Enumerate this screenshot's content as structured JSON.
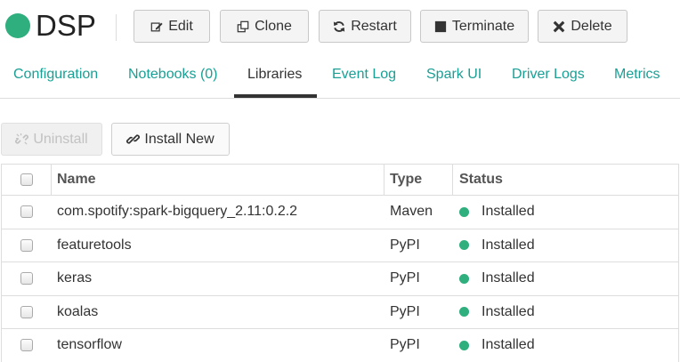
{
  "colors": {
    "accent": "#1a9f94",
    "status_ok": "#2fae7e",
    "active_tab": "#333333"
  },
  "cluster": {
    "name": "DSP",
    "status_icon": "green-status-dot"
  },
  "toolbar": {
    "edit": {
      "label": "Edit",
      "icon": "edit-icon"
    },
    "clone": {
      "label": "Clone",
      "icon": "clone-icon"
    },
    "restart": {
      "label": "Restart",
      "icon": "refresh-icon"
    },
    "terminate": {
      "label": "Terminate",
      "icon": "stop-icon"
    },
    "delete": {
      "label": "Delete",
      "icon": "x-icon"
    }
  },
  "tabs": [
    {
      "label": "Configuration"
    },
    {
      "label": "Notebooks (0)"
    },
    {
      "label": "Libraries",
      "active": true
    },
    {
      "label": "Event Log"
    },
    {
      "label": "Spark UI"
    },
    {
      "label": "Driver Logs"
    },
    {
      "label": "Metrics"
    }
  ],
  "actions": {
    "uninstall": {
      "label": "Uninstall",
      "disabled": true,
      "icon": "unlink-icon"
    },
    "install_new": {
      "label": "Install New",
      "icon": "link-icon"
    }
  },
  "table": {
    "columns": {
      "name": "Name",
      "type": "Type",
      "status": "Status"
    },
    "rows": [
      {
        "name": "com.spotify:spark-bigquery_2.11:0.2.2",
        "type": "Maven",
        "status": "Installed"
      },
      {
        "name": "featuretools",
        "type": "PyPI",
        "status": "Installed"
      },
      {
        "name": "keras",
        "type": "PyPI",
        "status": "Installed"
      },
      {
        "name": "koalas",
        "type": "PyPI",
        "status": "Installed"
      },
      {
        "name": "tensorflow",
        "type": "PyPI",
        "status": "Installed"
      }
    ]
  }
}
